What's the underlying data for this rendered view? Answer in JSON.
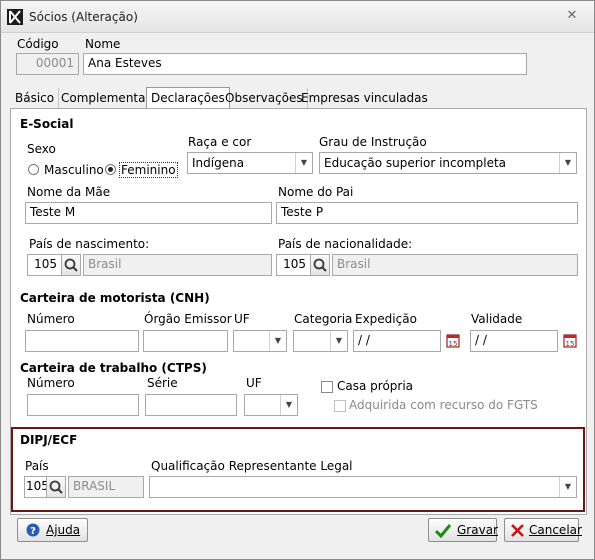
{
  "window": {
    "title": "Sócios (Alteração)"
  },
  "header": {
    "codigo_label": "Código",
    "codigo_value": "00001",
    "nome_label": "Nome",
    "nome_value": "Ana Esteves"
  },
  "tabs": [
    {
      "label": "Básico"
    },
    {
      "label": "Complementar"
    },
    {
      "label": "Declarações"
    },
    {
      "label": "Observações"
    },
    {
      "label": "Empresas vinculadas"
    }
  ],
  "esocial": {
    "section_title": "E-Social",
    "sexo_label": "Sexo",
    "sexo_options": [
      "Masculino",
      "Feminino"
    ],
    "sexo_selected": "Feminino",
    "raca_label": "Raça e cor",
    "raca_value": "Indígena",
    "grau_label": "Grau de Instrução",
    "grau_value": "Educação superior incompleta",
    "mae_label": "Nome da Mãe",
    "mae_value": "Teste M",
    "pai_label": "Nome do Pai",
    "pai_value": "Teste P",
    "pais_nasc_label": "País de nascimento:",
    "pais_nasc_code": "105",
    "pais_nasc_name": "Brasil",
    "pais_nac_label": "País de nacionalidade:",
    "pais_nac_code": "105",
    "pais_nac_name": "Brasil"
  },
  "cnh": {
    "section_title": "Carteira de motorista (CNH)",
    "numero_label": "Número",
    "numero_value": "",
    "orgao_label": "Órgão Emissor",
    "orgao_value": "",
    "uf_label": "UF",
    "uf_value": "",
    "categoria_label": "Categoria",
    "categoria_value": "",
    "expedicao_label": "Expedição",
    "expedicao_value": " / /",
    "validade_label": "Validade",
    "validade_value": " / /"
  },
  "ctps": {
    "section_title": "Carteira de trabalho (CTPS)",
    "numero_label": "Número",
    "numero_value": "",
    "serie_label": "Série",
    "serie_value": "",
    "uf_label": "UF",
    "uf_value": "",
    "casa_propria_label": "Casa própria",
    "fgts_label": "Adquirida com recurso do FGTS"
  },
  "dipj": {
    "section_title": "DIPJ/ECF",
    "pais_label": "País",
    "pais_code": "105",
    "pais_name": "BRASIL",
    "qualif_label": "Qualificação Representante Legal",
    "qualif_value": ""
  },
  "buttons": {
    "help": "Ajuda",
    "save": "Gravar",
    "cancel": "Cancelar"
  },
  "colors": {
    "dipj_border": "#6d1414",
    "save_icon": "#1a8a1a",
    "cancel_icon": "#c01818",
    "help_icon": "#2a5db0"
  }
}
